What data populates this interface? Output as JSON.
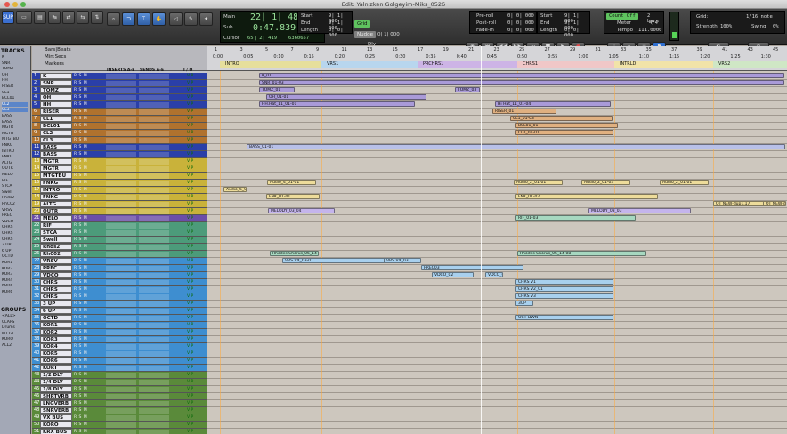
{
  "window_title": "Edit: Yalnizken Golgeyim-Miks_0526",
  "toolbar": {
    "sup_label": "SUP",
    "counter": {
      "main_label": "Main",
      "main_value": "22| 1| 483",
      "sub_label": "Sub",
      "sub_value": "0:47.839",
      "cursor_label": "Cursor",
      "cursor_value": "65| 2| 419",
      "cursor_samples": "6360657"
    },
    "selection": {
      "start_label": "Start",
      "end_label": "End",
      "length_label": "Length",
      "start_value": "9| 1| 000",
      "end_value": "9| 1| 000",
      "length_value": "0| 0| 000"
    },
    "grid_btn": "Grid",
    "nudge_btn": "Nudge",
    "nudge_value": "0| 1| 000",
    "dly_label": "Dly",
    "preroll": {
      "pre_label": "Pre-roll",
      "post_label": "Post-roll",
      "fadein_label": "Fade-in",
      "pre_value": "0| 0| 000",
      "post_value": "0| 0| 000",
      "fadein_value": "0| 0| 000"
    },
    "transport_sel": {
      "start_label": "Start",
      "end_label": "End",
      "length_label": "Length",
      "start_value": "9| 1| 000",
      "end_value": "9| 1| 000",
      "length_value": "0| 0| 000"
    },
    "midi": {
      "countoff": "Count Off",
      "bars": "2 bars",
      "meter_label": "Meter",
      "meter_value": "4/4",
      "tempo_label": "Tempo",
      "tempo_value": "111.0000"
    },
    "gridval": {
      "grid_label": "Grid:",
      "grid_value": "1/16 note",
      "strength_label": "Strength:",
      "strength_value": "100%",
      "swing_label": "Swing:",
      "swing_value": "0%"
    }
  },
  "left": {
    "tracks_header": "TRACKS",
    "groups_header": "GROUPS",
    "groups": [
      "<ALL>",
      "CLAPS",
      "Drums",
      "MT GT",
      "KORO",
      "ALL2"
    ]
  },
  "track_header": {
    "bars": "Bars|Beats",
    "minsecs": "Min:Secs",
    "markers": "Markers",
    "inserts": "INSERTS A-E",
    "sends": "SENDS A-E",
    "io": "I / O"
  },
  "ruler": {
    "bars": [
      "1",
      "3",
      "5",
      "7",
      "9",
      "11",
      "13",
      "15",
      "17",
      "19",
      "21",
      "23",
      "25",
      "27",
      "29",
      "31",
      "33",
      "35",
      "37",
      "39",
      "41",
      "43",
      "45"
    ],
    "mins": [
      "0:00",
      "0:05",
      "0:10",
      "0:15",
      "0:20",
      "0:25",
      "0:30",
      "0:35",
      "0:40",
      "0:45",
      "0:50",
      "0:55",
      "1:00",
      "1:05",
      "1:10",
      "1:15",
      "1:20",
      "1:25",
      "1:30"
    ],
    "markers": [
      "INTRO",
      "VRS1",
      "PRCHRS1",
      "CHRS1",
      "INTRLD",
      "VRS2"
    ]
  },
  "tracks": [
    {
      "n": "1",
      "name": "K",
      "color": "#2a3fa8"
    },
    {
      "n": "2",
      "name": "SNR",
      "color": "#2a3fa8"
    },
    {
      "n": "3",
      "name": "TOMZ",
      "color": "#2a3fa8"
    },
    {
      "n": "4",
      "name": "OH",
      "color": "#2a3fa8"
    },
    {
      "n": "5",
      "name": "HH",
      "color": "#2a3fa8"
    },
    {
      "n": "6",
      "name": "RISER",
      "color": "#b0722e"
    },
    {
      "n": "7",
      "name": "CL1",
      "color": "#b0722e"
    },
    {
      "n": "8",
      "name": "BCL01",
      "color": "#b0722e"
    },
    {
      "n": "9",
      "name": "CL2",
      "color": "#b0722e"
    },
    {
      "n": "10",
      "name": "CL3",
      "color": "#b0722e"
    },
    {
      "n": "11",
      "name": "BASS",
      "color": "#2a3fa8"
    },
    {
      "n": "12",
      "name": "BASS",
      "color": "#2a3fa8"
    },
    {
      "n": "13",
      "name": "MGTR",
      "color": "#c9b23a"
    },
    {
      "n": "14",
      "name": "MGTR",
      "color": "#c9b23a"
    },
    {
      "n": "15",
      "name": "MTGTBU",
      "color": "#c9b23a"
    },
    {
      "n": "16",
      "name": "FNKG",
      "color": "#c9b23a"
    },
    {
      "n": "17",
      "name": "INTRO",
      "color": "#c9b23a"
    },
    {
      "n": "18",
      "name": "FNKG",
      "color": "#c9b23a"
    },
    {
      "n": "19",
      "name": "ALTG",
      "color": "#c9b23a"
    },
    {
      "n": "20",
      "name": "OUTR",
      "color": "#c9b23a"
    },
    {
      "n": "21",
      "name": "MELO",
      "color": "#6b4ea8"
    },
    {
      "n": "22",
      "name": "RIF",
      "color": "#4c9b7a"
    },
    {
      "n": "23",
      "name": "STCA",
      "color": "#4c9b7a"
    },
    {
      "n": "24",
      "name": "Swell",
      "color": "#4c9b7a"
    },
    {
      "n": "25",
      "name": "Rhds2",
      "color": "#4c9b7a"
    },
    {
      "n": "26",
      "name": "RhC02",
      "color": "#4c9b7a"
    },
    {
      "n": "27",
      "name": "VRSV",
      "color": "#3e8ed0"
    },
    {
      "n": "28",
      "name": "PREC",
      "color": "#3e8ed0"
    },
    {
      "n": "29",
      "name": "VDCO",
      "color": "#3e8ed0"
    },
    {
      "n": "30",
      "name": "CHRS",
      "color": "#3e8ed0"
    },
    {
      "n": "31",
      "name": "CHRS",
      "color": "#3e8ed0"
    },
    {
      "n": "32",
      "name": "CHRS",
      "color": "#3e8ed0"
    },
    {
      "n": "33",
      "name": "3 UP",
      "color": "#3e8ed0"
    },
    {
      "n": "34",
      "name": "6 UP",
      "color": "#3e8ed0"
    },
    {
      "n": "35",
      "name": "OCTD",
      "color": "#3e8ed0"
    },
    {
      "n": "36",
      "name": "KOR1",
      "color": "#3e8ed0"
    },
    {
      "n": "37",
      "name": "KOR2",
      "color": "#3e8ed0"
    },
    {
      "n": "38",
      "name": "KOR3",
      "color": "#3e8ed0"
    },
    {
      "n": "39",
      "name": "KOR4",
      "color": "#3e8ed0"
    },
    {
      "n": "40",
      "name": "KOR5",
      "color": "#3e8ed0"
    },
    {
      "n": "41",
      "name": "KOR6",
      "color": "#3e8ed0"
    },
    {
      "n": "42",
      "name": "KORT",
      "color": "#3e8ed0"
    },
    {
      "n": "43",
      "name": "1/2 DLY",
      "color": "#5a8a3a"
    },
    {
      "n": "44",
      "name": "1/4 DLY",
      "color": "#5a8a3a"
    },
    {
      "n": "45",
      "name": "1/8 DLY",
      "color": "#5a8a3a"
    },
    {
      "n": "46",
      "name": "SHRTVRB",
      "color": "#5a8a3a"
    },
    {
      "n": "47",
      "name": "LNGVERB",
      "color": "#5a8a3a"
    },
    {
      "n": "48",
      "name": "SNRVERB",
      "color": "#5a8a3a"
    },
    {
      "n": "49",
      "name": "VX BUS",
      "color": "#5a8a3a"
    },
    {
      "n": "50",
      "name": "KORO",
      "color": "#5a8a3a"
    },
    {
      "n": "51",
      "name": "KRX BUS",
      "color": "#5a8a3a"
    }
  ],
  "clips": [
    {
      "lane": 0,
      "label": "K_01",
      "color": "#a99ad8"
    },
    {
      "lane": 1,
      "label": "SNR_01-03",
      "color": "#a99ad8"
    },
    {
      "lane": 2,
      "label": "TOMZ_01",
      "color": "#a99ad8"
    },
    {
      "lane": 2,
      "label": "TOMZ_03",
      "color": "#a99ad8"
    },
    {
      "lane": 3,
      "label": "OH_01-01",
      "color": "#a99ad8"
    },
    {
      "lane": 4,
      "label": "HH.Hat_11_01-01",
      "color": "#a99ad8"
    },
    {
      "lane": 4,
      "label": "Hi Hat_11_01-04",
      "color": "#a99ad8"
    },
    {
      "lane": 5,
      "label": "RISER_01",
      "color": "#e0b080"
    },
    {
      "lane": 6,
      "label": "CL1_01-03",
      "color": "#e0b080"
    },
    {
      "lane": 7,
      "label": "BCL01_01",
      "color": "#e0b080"
    },
    {
      "lane": 8,
      "label": "CL2_01-01",
      "color": "#e0b080"
    },
    {
      "lane": 10,
      "label": "BASS_01-01",
      "color": "#b8c0e8"
    },
    {
      "lane": 15,
      "label": "Audio_4_01-01",
      "color": "#eddc9a"
    },
    {
      "lane": 15,
      "label": "Audio_2_01-01",
      "color": "#eddc9a"
    },
    {
      "lane": 15,
      "label": "Audio_2_01-03",
      "color": "#eddc9a"
    },
    {
      "lane": 15,
      "label": "Audio_2_01-01",
      "color": "#eddc9a"
    },
    {
      "lane": 16,
      "label": "Audio_6_01",
      "color": "#eddc9a"
    },
    {
      "lane": 17,
      "label": "FNK_01-01",
      "color": "#eddc9a"
    },
    {
      "lane": 17,
      "label": "FNK_01-02",
      "color": "#eddc9a"
    },
    {
      "lane": 18,
      "label": "OT NEW-dup1.17",
      "color": "#eddc9a"
    },
    {
      "lane": 18,
      "label": "OT NEW-dup1.13",
      "color": "#eddc9a"
    },
    {
      "lane": 19,
      "label": "MELODY_03_04",
      "color": "#c4b4ec"
    },
    {
      "lane": 19,
      "label": "MELODY_03_03",
      "color": "#c4b4ec"
    },
    {
      "lane": 20,
      "label": "RIF_01-03",
      "color": "#a6d8c0"
    },
    {
      "lane": 25,
      "label": "Rhodes Chorus_06_14",
      "color": "#a6d8c0"
    },
    {
      "lane": 25,
      "label": "Rhodes Chorus_06_14-08",
      "color": "#a6d8c0"
    },
    {
      "lane": 26,
      "label": "VRS VX_03-01",
      "color": "#a8d0ee"
    },
    {
      "lane": 26,
      "label": "VRS VX_03",
      "color": "#a8d0ee"
    },
    {
      "lane": 27,
      "label": "PREC03",
      "color": "#a8d0ee"
    },
    {
      "lane": 28,
      "label": "VDCO_02",
      "color": "#a8d0ee"
    },
    {
      "lane": 28,
      "label": "VDCO_01",
      "color": "#a8d0ee"
    },
    {
      "lane": 29,
      "label": "CHRS V1",
      "color": "#a8d0ee"
    },
    {
      "lane": 30,
      "label": "CHRS V2_01",
      "color": "#a8d0ee"
    },
    {
      "lane": 31,
      "label": "CHRS V3",
      "color": "#a8d0ee"
    },
    {
      "lane": 32,
      "label": "3UP",
      "color": "#a8d0ee"
    },
    {
      "lane": 34,
      "label": "OCT DWN",
      "color": "#a8d0ee"
    }
  ]
}
